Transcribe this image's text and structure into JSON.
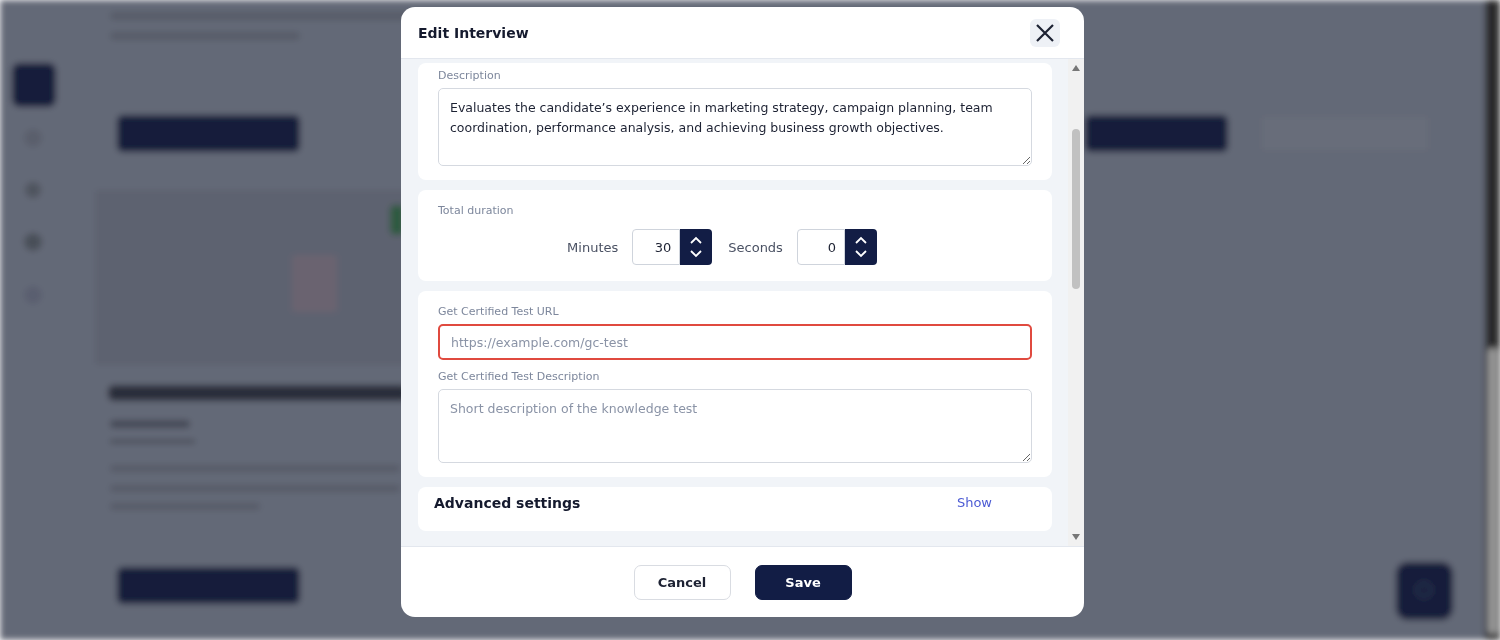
{
  "dialog": {
    "title": "Edit Interview",
    "sections": [
      {
        "kind": "textarea",
        "label": "Description",
        "value": "Evaluates the candidate’s experience in marketing strategy, campaign planning, team coordination, performance analysis, and achieving business growth objectives."
      },
      {
        "kind": "duration",
        "label": "Total duration",
        "fields": [
          {
            "label": "Minutes",
            "value": "30"
          },
          {
            "label": "Seconds",
            "value": "0"
          }
        ]
      },
      {
        "kind": "fields",
        "fields": [
          {
            "kind": "input",
            "label": "Get Certified Test URL",
            "placeholder": "https://example.com/gc-test",
            "error": true
          },
          {
            "kind": "textarea",
            "label": "Get Certified Test Description",
            "placeholder": "Short description of the knowledge test",
            "error": false
          }
        ]
      },
      {
        "kind": "collapsible",
        "label": "Advanced settings",
        "link": "Show"
      }
    ],
    "buttons": [
      {
        "label": "Cancel",
        "primary": false
      },
      {
        "label": "Save",
        "primary": true
      }
    ]
  }
}
